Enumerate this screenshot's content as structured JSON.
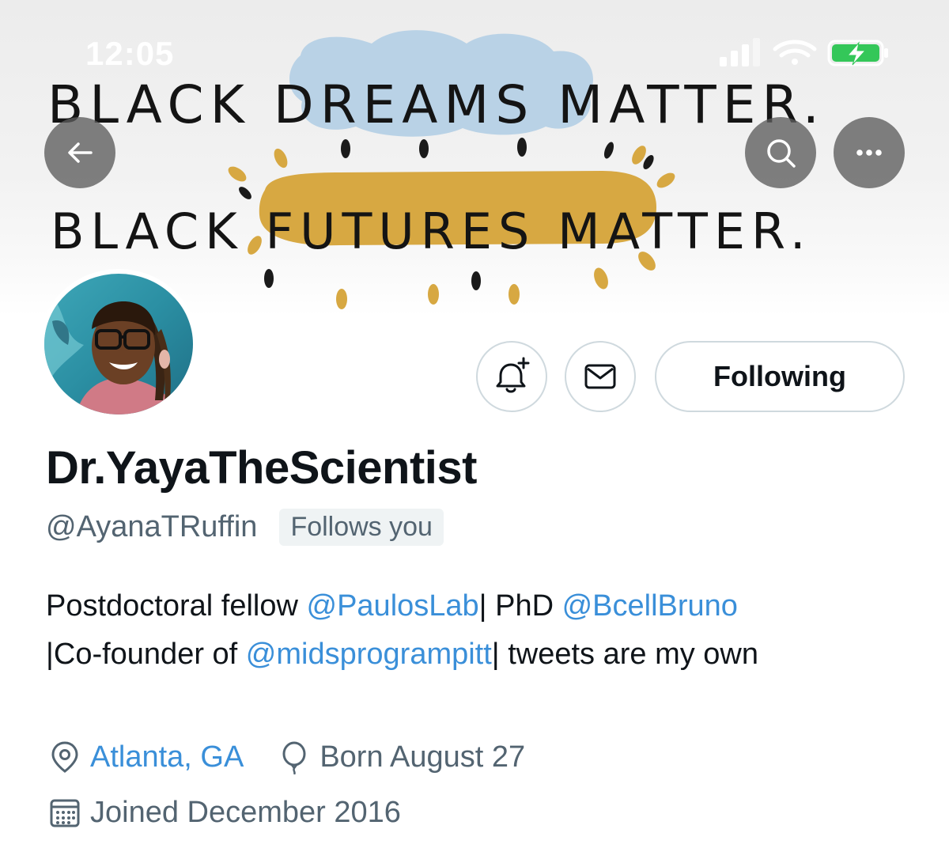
{
  "status_bar": {
    "time": "12:05",
    "icons": [
      "signal-icon",
      "wifi-icon",
      "battery-charging-icon"
    ]
  },
  "banner": {
    "line1_a": "BLACK",
    "line1_b": "DREAMS",
    "line1_c": "MATTER.",
    "line2_a": "BLACK",
    "line2_b": "FUTURES",
    "line2_c": "MATTER."
  },
  "header_buttons": {
    "back": "back-arrow-icon",
    "search": "search-icon",
    "more": "more-icon"
  },
  "actions": {
    "notify_icon": "bell-plus-icon",
    "message_icon": "envelope-icon",
    "following_label": "Following"
  },
  "profile": {
    "display_name": "Dr.YayaTheScientist",
    "handle": "@AyanaTRuffin",
    "follows_you": "Follows you",
    "bio": {
      "part1": "Postdoctoral fellow ",
      "mention1": "@PaulosLab",
      "part2": "| PhD ",
      "mention2": "@BcellBruno",
      "part3": "|Co-founder of ",
      "mention3": "@midsprogrampitt",
      "part4": "| tweets are my own"
    },
    "location": "Atlanta, GA",
    "birthday": "Born August 27",
    "joined": "Joined December 2016"
  },
  "colors": {
    "link": "#3a8fd9",
    "secondary_text": "#536471",
    "primary_text": "#0f1419",
    "border": "#cfd9de",
    "badge_bg": "#eff3f4",
    "banner_cloud": "#b9d2e6",
    "banner_pill": "#d7a842"
  }
}
